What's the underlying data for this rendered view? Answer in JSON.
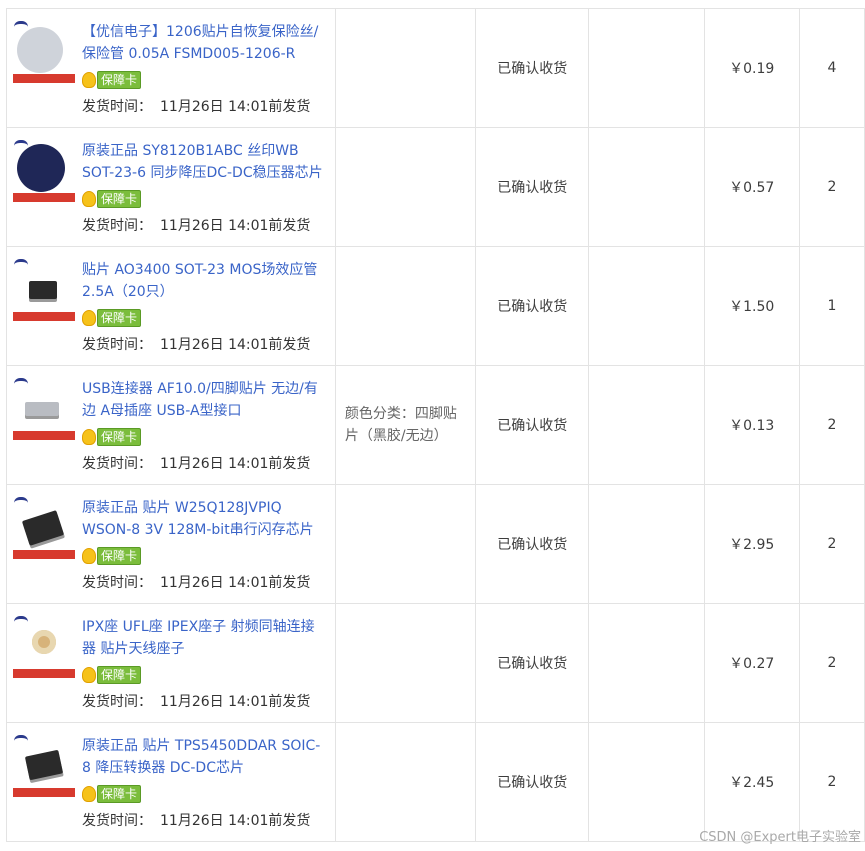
{
  "orders": [
    {
      "title": "【优信电子】1206贴片自恢复保险丝/保险管 0.05A FSMD005-1206-R",
      "thumb": "fuse-reel",
      "badge": "保障卡",
      "ship_label": "发货时间：",
      "ship_time": "11月26日 14:01前发货",
      "sku": "",
      "status": "已确认收货",
      "memo": "",
      "price": "￥0.19",
      "qty": "4"
    },
    {
      "title": "原装正品 SY8120B1ABC 丝印WB SOT-23-6 同步降压DC-DC稳压器芯片",
      "thumb": "sot23-reel",
      "badge": "保障卡",
      "ship_label": "发货时间：",
      "ship_time": "11月26日 14:01前发货",
      "sku": "",
      "status": "已确认收货",
      "memo": "",
      "price": "￥0.57",
      "qty": "2"
    },
    {
      "title": "贴片 AO3400 SOT-23 MOS场效应管 2.5A（20只）",
      "thumb": "sot23-chip",
      "badge": "保障卡",
      "ship_label": "发货时间：",
      "ship_time": "11月26日 14:01前发货",
      "sku": "",
      "status": "已确认收货",
      "memo": "",
      "price": "￥1.50",
      "qty": "1"
    },
    {
      "title": "USB连接器 AF10.0/四脚贴片 无边/有边 A母插座 USB-A型接口",
      "thumb": "usb-connector",
      "badge": "保障卡",
      "ship_label": "发货时间：",
      "ship_time": "11月26日 14:01前发货",
      "sku": "颜色分类：四脚贴片（黑胶/无边）",
      "status": "已确认收货",
      "memo": "",
      "price": "￥0.13",
      "qty": "2"
    },
    {
      "title": "原装正品 贴片 W25Q128JVPIQ WSON-8 3V 128M-bit串行闪存芯片",
      "thumb": "flash-chip",
      "badge": "保障卡",
      "ship_label": "发货时间：",
      "ship_time": "11月26日 14:01前发货",
      "sku": "",
      "status": "已确认收货",
      "memo": "",
      "price": "￥2.95",
      "qty": "2"
    },
    {
      "title": "IPX座 UFL座 IPEX座子 射频同轴连接器 贴片天线座子",
      "thumb": "ipex-connector",
      "badge": "保障卡",
      "ship_label": "发货时间：",
      "ship_time": "11月26日 14:01前发货",
      "sku": "",
      "status": "已确认收货",
      "memo": "",
      "price": "￥0.27",
      "qty": "2"
    },
    {
      "title": "原装正品 贴片 TPS5450DDAR SOIC-8 降压转换器 DC-DC芯片",
      "thumb": "soic-chip",
      "badge": "保障卡",
      "ship_label": "发货时间：",
      "ship_time": "11月26日 14:01前发货",
      "sku": "",
      "status": "已确认收货",
      "memo": "",
      "price": "￥2.45",
      "qty": "2"
    }
  ],
  "watermark": "CSDN @Expert电子实验室",
  "colors": {
    "link": "#3a64c8",
    "border": "#e3e3e3",
    "badge_green": "#7bbd3c",
    "medal_gold": "#f6c21a",
    "thumb_stripe": "#d73a2e"
  }
}
